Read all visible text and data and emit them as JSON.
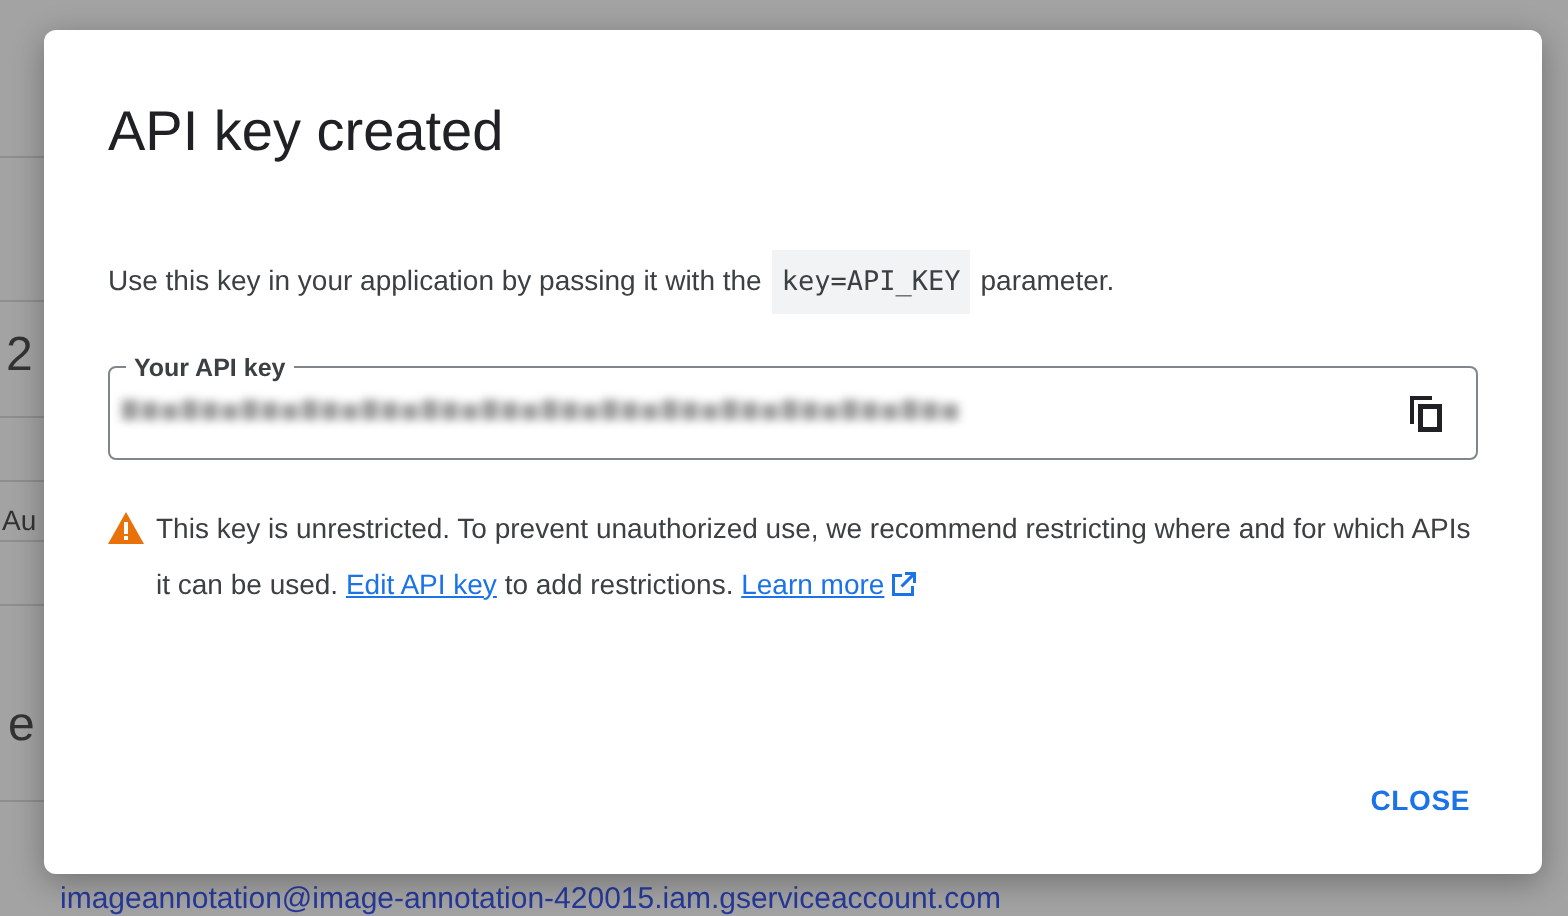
{
  "background": {
    "fragments": [
      "2",
      "Au",
      "e"
    ],
    "email": "imageannotation@image-annotation-420015.iam.gserviceaccount.com"
  },
  "dialog": {
    "title": "API key created",
    "description": {
      "before": "Use this key in your application by passing it with the",
      "code": "key=API_KEY",
      "after": "parameter."
    },
    "field": {
      "label": "Your API key"
    },
    "warning": {
      "text": "This key is unrestricted. To prevent unauthorized use, we recommend restricting where and for which APIs it can be used.",
      "link": "Edit API key",
      "after": "to add restrictions.",
      "learn_more": "Learn more"
    },
    "buttons": [
      "CLOSE"
    ]
  }
}
